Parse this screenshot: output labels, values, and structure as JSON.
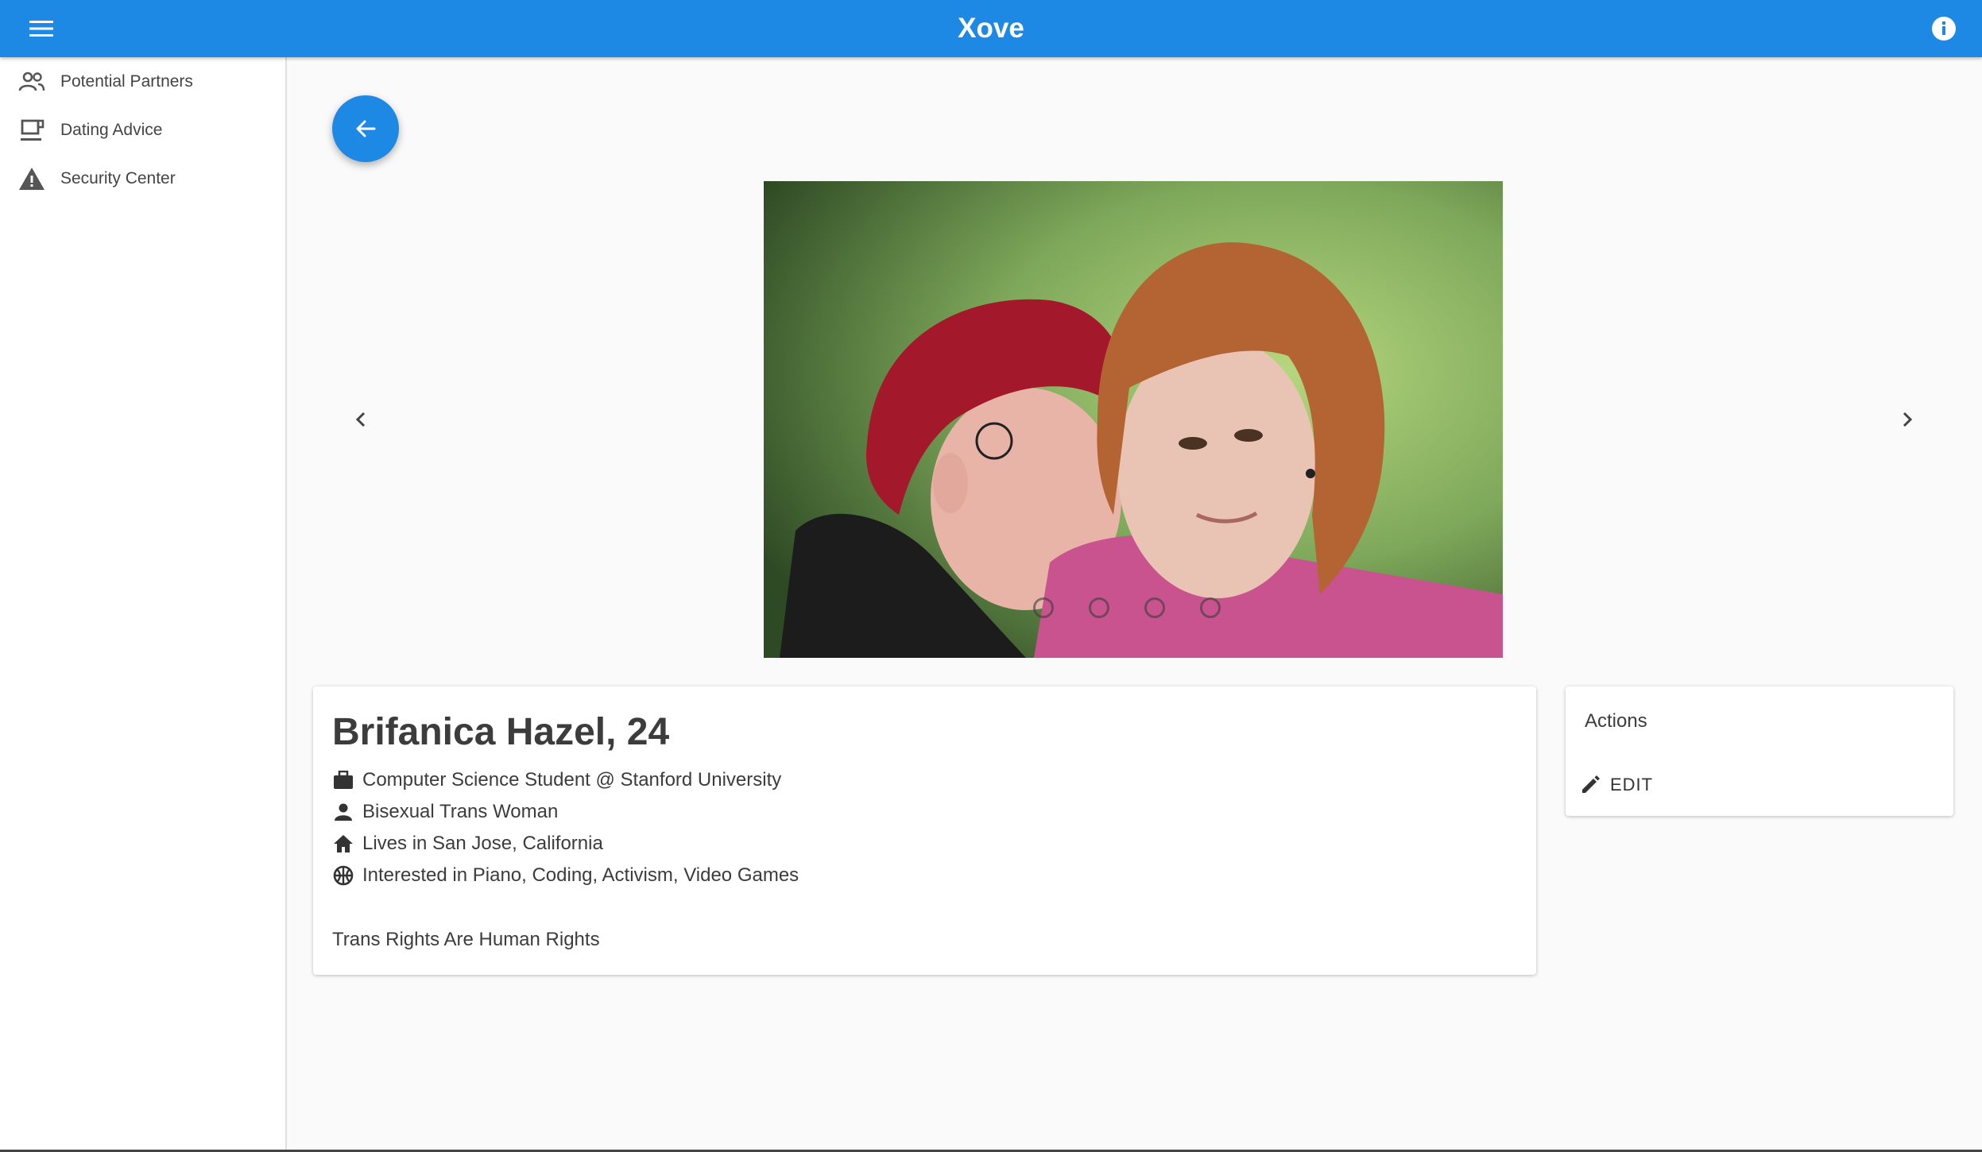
{
  "app": {
    "title": "Xove",
    "brand_color": "#1e88e5"
  },
  "topbar": {
    "menu_icon": "menu-icon",
    "info_icon": "info-icon"
  },
  "sidebar": {
    "items": [
      {
        "label": "Potential Partners",
        "icon": "people-icon"
      },
      {
        "label": "Dating Advice",
        "icon": "coffee-cup-icon"
      },
      {
        "label": "Security Center",
        "icon": "warning-icon"
      }
    ]
  },
  "carousel": {
    "image_alt": "Two women, one with red hair kissing the cheek of another with long auburn hair",
    "slide_count": 4,
    "active_index": 0
  },
  "profile": {
    "name_age": "Brifanica Hazel, 24",
    "occupation": "Computer Science Student @ Stanford University",
    "identity": "Bisexual Trans Woman",
    "location": "Lives in San Jose, California",
    "interests": "Interested in Piano, Coding, Activism, Video Games",
    "bio": "Trans Rights Are Human Rights"
  },
  "actions": {
    "heading": "Actions",
    "edit_label": "EDIT"
  }
}
